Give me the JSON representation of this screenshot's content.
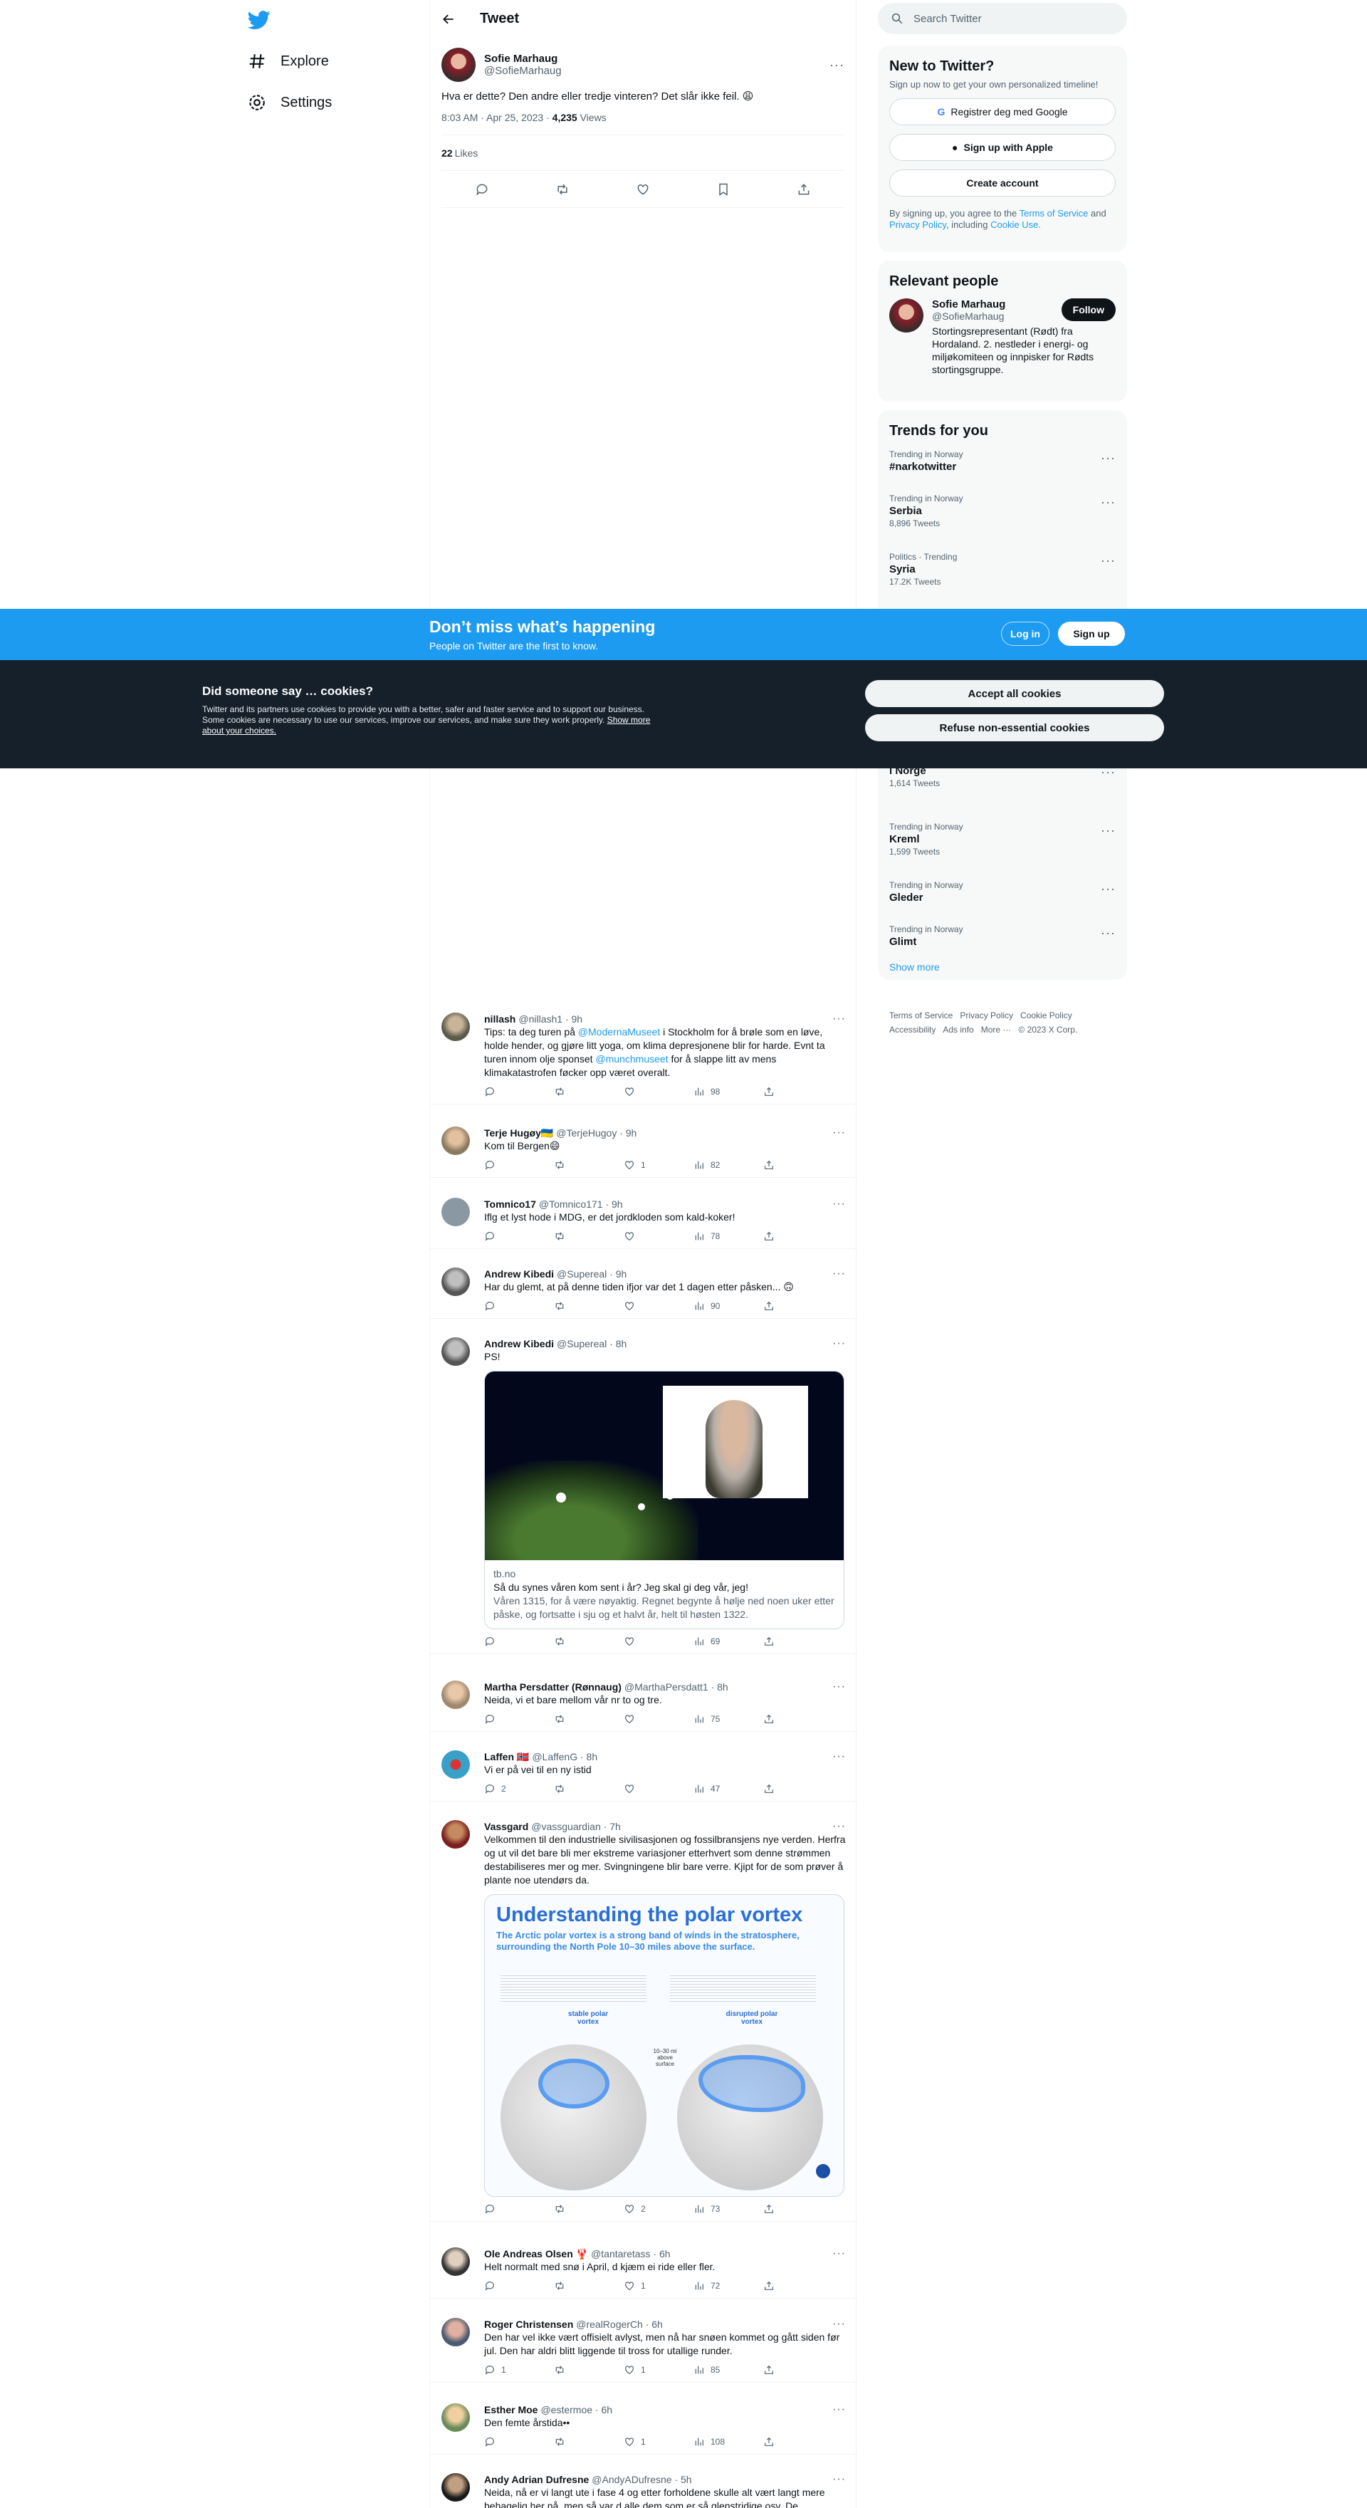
{
  "nav": {
    "explore": "Explore",
    "settings": "Settings"
  },
  "header": {
    "title": "Tweet"
  },
  "focal": {
    "name": "Sofie Marhaug",
    "handle": "@SofieMarhaug",
    "text": "Hva er dette? Den andre eller tredje vinteren? Det slår ikke feil. 😩",
    "time": "8:03 AM · Apr 25, 2023 · ",
    "views_count": "4,235",
    "views_label": " Views",
    "likes_count": "22",
    "likes_label": "Likes"
  },
  "replies": [
    {
      "name": "nillash",
      "handle": "@nillash1 · 9h",
      "text_parts": [
        "Tips: ta deg turen på ",
        "@ModernaMuseet",
        " i Stockholm for å brøle som en løve, holde hender, og gjøre litt yoga, om klima depresjonene blir for harde. Evnt ta turen innom olje sponset ",
        "@munchmuseet",
        " for å slappe litt av mens klimakatastrofen føcker opp været overalt."
      ],
      "reply": "",
      "retweet": "",
      "like": "",
      "views": "98"
    },
    {
      "name": "Terje Hugøy🇺🇦",
      "handle": "@TerjeHugoy · 9h",
      "text": "Kom til Bergen😄",
      "reply": "",
      "retweet": "",
      "like": "1",
      "views": "82"
    },
    {
      "name": "Tomnico17",
      "handle": "@Tomnico171 · 9h",
      "text": "Iflg et lyst hode i MDG, er det jordkloden som kald-koker!",
      "reply": "",
      "retweet": "",
      "like": "",
      "views": "78"
    },
    {
      "name": "Andrew Kibedi",
      "handle": "@Supereal · 9h",
      "text": "Har du glemt, at på denne tiden ifjor var det 1 dagen etter påsken... 🙃",
      "reply": "",
      "retweet": "",
      "like": "",
      "views": "90"
    },
    {
      "name": "Andrew Kibedi",
      "handle": "@Supereal · 8h",
      "text": "PS!",
      "card_domain": "tb.no",
      "card_title": "Så du synes våren kom sent i år? Jeg skal gi deg vår, jeg!",
      "card_desc": "Våren 1315, for å være nøyaktig. Regnet begynte å hølje ned noen uker etter påske, og fortsatte i sju og et halvt år, helt til høsten 1322.",
      "reply": "",
      "retweet": "",
      "like": "",
      "views": "69"
    },
    {
      "name": "Martha Persdatter (Rønnaug)",
      "handle": "@MarthaPersdatt1 · 8h",
      "text": "Neida, vi et bare mellom vår nr to og tre.",
      "reply": "",
      "retweet": "",
      "like": "",
      "views": "75"
    },
    {
      "name": "Laffen 🇳🇴",
      "handle": "@LaffenG · 8h",
      "text": "Vi er på vei til en ny istid",
      "reply": "2",
      "retweet": "",
      "like": "",
      "views": "47"
    },
    {
      "name": "Vassgard",
      "handle": "@vassguardian · 7h",
      "text": "Velkommen til den industrielle sivilisasjonen og fossilbransjens nye verden. Herfra og ut vil det bare bli mer ekstreme variasjoner etterhvert som denne strømmen destabiliseres mer og mer. Svingningene blir bare verre. Kjipt for de som prøver å plante noe utendørs da.",
      "reply": "",
      "retweet": "",
      "like": "2",
      "views": "73"
    },
    {
      "name": "Ole Andreas Olsen 🦞",
      "handle": "@tantaretass · 6h",
      "text": "Helt normalt med snø i April, d kjæm ei ride eller fler.",
      "reply": "",
      "retweet": "",
      "like": "1",
      "views": "72"
    },
    {
      "name": "Roger Christensen",
      "handle": "@realRogerCh · 6h",
      "text": "Den har vel ikke vært offisielt avlyst, men nå har snøen kommet og gått siden før jul. Den har aldri blitt liggende til tross for utallige runder.",
      "reply": "1",
      "retweet": "",
      "like": "1",
      "views": "85"
    },
    {
      "name": "Esther Moe",
      "handle": "@estermoe · 6h",
      "text": "Den femte årstida••",
      "reply": "",
      "retweet": "",
      "like": "1",
      "views": "108"
    },
    {
      "name": "Andy Adrian Dufresne",
      "handle": "@AndyADufresne · 5h",
      "text": "Neida, nå er vi langt ute i fase 4 og etter forholdene skulle alt vært langt mere behagelig her nå, men så var d alle dem som er så glenstridige osv. De",
      "reply": "",
      "retweet": "",
      "like": "",
      "views": ""
    }
  ],
  "vortex": {
    "title": "Understanding the polar vortex",
    "subtitle": "The Arctic polar vortex is a strong band of winds in the stratosphere, surrounding the North Pole 10–30 miles above the surface.",
    "stable": "stable polar vortex",
    "disrupted": "disrupted polar vortex",
    "mid": "10–30 mi above surface"
  },
  "sidebar": {
    "search_placeholder": "Search Twitter",
    "new_title": "New to Twitter?",
    "new_sub": "Sign up now to get your own personalized timeline!",
    "google": "Registrer deg med Google",
    "apple": "Sign up with Apple",
    "create": "Create account",
    "legal_pre": "By signing up, you agree to the ",
    "terms": "Terms of Service",
    "and": " and ",
    "privacy": "Privacy Policy",
    "including": ", including ",
    "cookie_use": "Cookie Use.",
    "relevant_title": "Relevant people",
    "person_name": "Sofie Marhaug",
    "person_handle": "@SofieMarhaug",
    "follow": "Follow",
    "person_bio": "Stortingsrepresentant (Rødt) fra Hordaland. 2. nestleder i energi- og miljøkomiteen og innpisker for Rødts stortingsgruppe.",
    "trends_title": "Trends for you",
    "trends_top": [
      {
        "cat": "Trending in Norway",
        "title": "#narkotwitter",
        "count": ""
      },
      {
        "cat": "Trending in Norway",
        "title": "Serbia",
        "count": "8,896 Tweets"
      },
      {
        "cat": "Politics · Trending",
        "title": "Syria",
        "count": "17.2K Tweets"
      }
    ],
    "trends_bottom": [
      {
        "cat": "",
        "title": "i Norge",
        "count": "1,614 Tweets"
      },
      {
        "cat": "Trending in Norway",
        "title": "Kreml",
        "count": "1,599 Tweets"
      },
      {
        "cat": "Trending in Norway",
        "title": "Gleder",
        "count": ""
      },
      {
        "cat": "Trending in Norway",
        "title": "Glimt",
        "count": ""
      }
    ],
    "show_more": "Show more",
    "footer": [
      "Terms of Service",
      "Privacy Policy",
      "Cookie Policy",
      "Accessibility",
      "Ads info",
      "More ···",
      "© 2023 X Corp."
    ]
  },
  "happening": {
    "title": "Don’t miss what’s happening",
    "sub": "People on Twitter are the first to know.",
    "login": "Log in",
    "signup": "Sign up"
  },
  "cookies": {
    "title": "Did someone say … cookies?",
    "body": "Twitter and its partners use cookies to provide you with a better, safer and faster service and to support our business. Some cookies are necessary to use our services, improve our services, and make sure they work properly. ",
    "link": "Show more about your choices.",
    "accept": "Accept all cookies",
    "refuse": "Refuse non-essential cookies"
  },
  "colors": {
    "accent": "#1d9bf0",
    "text": "#0f1419",
    "muted": "#536471",
    "dark": "#15202b"
  }
}
